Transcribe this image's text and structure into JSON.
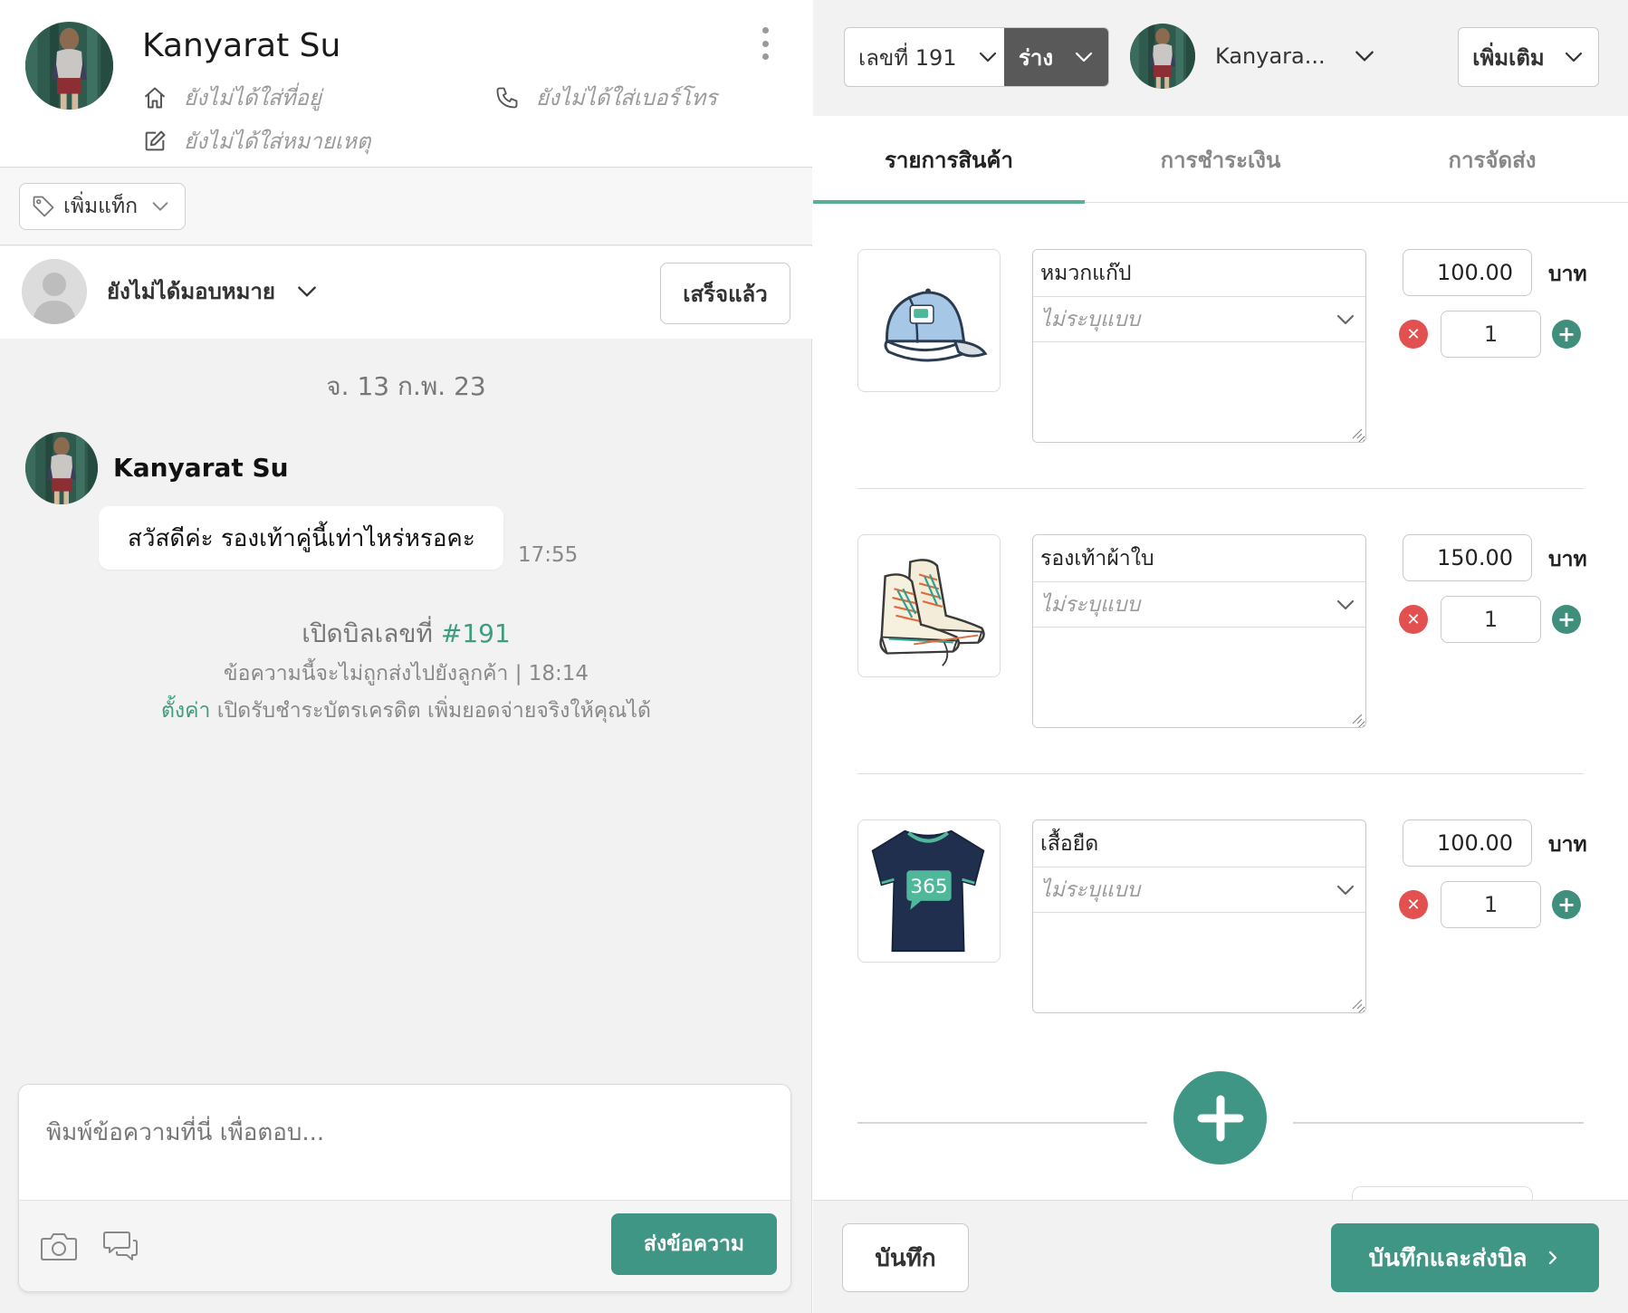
{
  "contact": {
    "name": "Kanyarat Su",
    "address_placeholder": "ยังไม่ได้ใส่ที่อยู่",
    "phone_placeholder": "ยังไม่ได้ใส่เบอร์โทร",
    "note_placeholder": "ยังไม่ได้ใส่หมายเหตุ"
  },
  "tags": {
    "add_label": "เพิ่มแท็ก"
  },
  "assignment": {
    "label": "ยังไม่ได้มอบหมาย",
    "done_label": "เสร็จแล้ว"
  },
  "chat": {
    "date": "จ. 13 ก.พ. 23",
    "message": {
      "sender": "Kanyarat Su",
      "text": "สวัสดีค่ะ รองเท้าคู่นี้เท่าไหร่หรอคะ",
      "time": "17:55"
    },
    "bill_event": {
      "title": "เปิดบิลเลขที่",
      "number": "#191",
      "note": "ข้อความนี้จะไม่ถูกส่งไปยังลูกค้า | 18:14",
      "setting_link": "ตั้งค่า",
      "setting_text": " เปิดรับชำระบัตรเครดิต เพิ่มยอดจ่ายจริงให้คุณได้"
    }
  },
  "composer": {
    "placeholder": "พิมพ์ข้อความที่นี่ เพื่อตอบ...",
    "send_label": "ส่งข้อความ"
  },
  "order": {
    "bill_number": "เลขที่ 191",
    "status": "ร่าง",
    "customer": "Kanyara...",
    "more_label": "เพิ่มเติม",
    "tabs": [
      {
        "label": "รายการสินค้า"
      },
      {
        "label": "การชำระเงิน"
      },
      {
        "label": "การจัดส่ง"
      }
    ],
    "currency": "บาท",
    "items": [
      {
        "name": "หมวกแก๊ป",
        "variant": "ไม่ระบุแบบ",
        "price": "100.00",
        "qty": "1",
        "image": "cap"
      },
      {
        "name": "รองเท้าผ้าใบ",
        "variant": "ไม่ระบุแบบ",
        "price": "150.00",
        "qty": "1",
        "image": "sneakers"
      },
      {
        "name": "เสื้อยืด",
        "variant": "ไม่ระบุแบบ",
        "price": "100.00",
        "qty": "1",
        "image": "tshirt",
        "print": "365"
      }
    ],
    "save_label": "บันทึก",
    "save_send_label": "บันทึกและส่งบิล"
  },
  "colors": {
    "accent": "#3f9684",
    "link": "#3f9c80",
    "danger": "#e35050",
    "status_bg": "#595959"
  }
}
